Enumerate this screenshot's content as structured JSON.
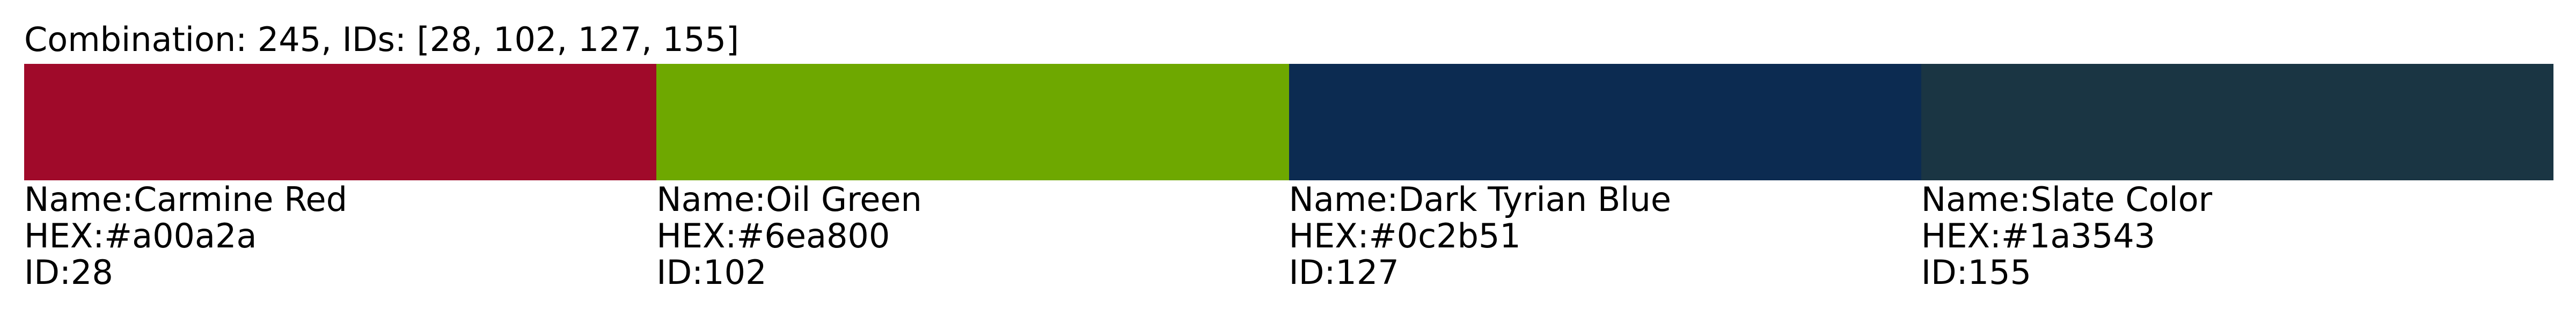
{
  "title": {
    "prefix": "Combination: ",
    "combination": "245",
    "ids_label": ", IDs: ",
    "ids_text": "[28, 102, 127, 155]"
  },
  "labels": {
    "name": "Name: ",
    "hex": "HEX: ",
    "id": "ID: "
  },
  "colors": [
    {
      "name": "Carmine Red",
      "hex": "#a00a2a",
      "id": "28"
    },
    {
      "name": "Oil Green",
      "hex": "#6ea800",
      "id": "102"
    },
    {
      "name": "Dark Tyrian Blue",
      "hex": "#0c2b51",
      "id": "127"
    },
    {
      "name": "Slate Color",
      "hex": "#1a3543",
      "id": "155"
    }
  ]
}
